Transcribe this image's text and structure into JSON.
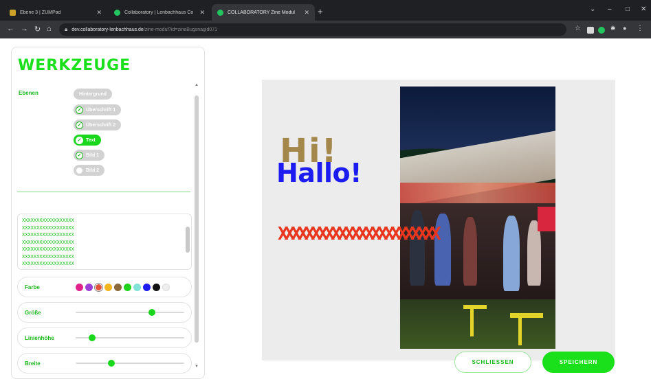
{
  "browser": {
    "tabs": [
      {
        "label": "Ebene 3 | ZUMPad"
      },
      {
        "label": "Collaboratory | Lenbachhaus Co"
      },
      {
        "label": "COLLABORATORY Zine Modul"
      }
    ],
    "new_tab": "+",
    "url_host": "dev.collaboratory-lenbachhaus.de",
    "url_path": "/zine-modul?id=zineBugsnagid071"
  },
  "tools": {
    "title": "WERKZEUGE",
    "layers_label": "Ebenen",
    "layers": [
      {
        "label": "Hintergrund",
        "checked": false,
        "active": false
      },
      {
        "label": "Überschrift 1",
        "checked": true,
        "active": false
      },
      {
        "label": "Überschrift 2",
        "checked": true,
        "active": false
      },
      {
        "label": "Text",
        "checked": true,
        "active": true
      },
      {
        "label": "Bild 1",
        "checked": true,
        "active": false
      },
      {
        "label": "Bild 2",
        "checked": false,
        "active": false
      }
    ],
    "textarea_lines": [
      "XXXXXXXXXXXXXXXXXX",
      "XXXXXXXXXXXXXXXXXX",
      "XXXXXXXXXXXXXXXXXX",
      "XXXXXXXXXXXXXXXXXX",
      "XXXXXXXXXXXXXXXXXX",
      "XXXXXXXXXXXXXXXXXX",
      "XXXXXXXXXXXXXXXXXX"
    ],
    "color_label": "Farbe",
    "colors": [
      "#e0218a",
      "#9b3fd6",
      "#e2543a",
      "#f2b61b",
      "#8a6a3a",
      "#1ed31e",
      "#7fe3d8",
      "#1c1cf0",
      "#111111",
      "#eeeeee"
    ],
    "selected_color": "#e2543a",
    "size_label": "Größe",
    "size_value": 0.7,
    "line_height_label": "Linienhöhe",
    "line_height_value": 0.15,
    "width_label": "Breite",
    "width_value": 0.33
  },
  "canvas": {
    "heading_hi": "Hi!",
    "heading_hallo": "Hallo!",
    "x_pattern": "XXXXXXXXXXXXXXXXXXXXXXXX"
  },
  "actions": {
    "close_label": "SCHLIESSEN",
    "save_label": "SPEICHERN"
  }
}
